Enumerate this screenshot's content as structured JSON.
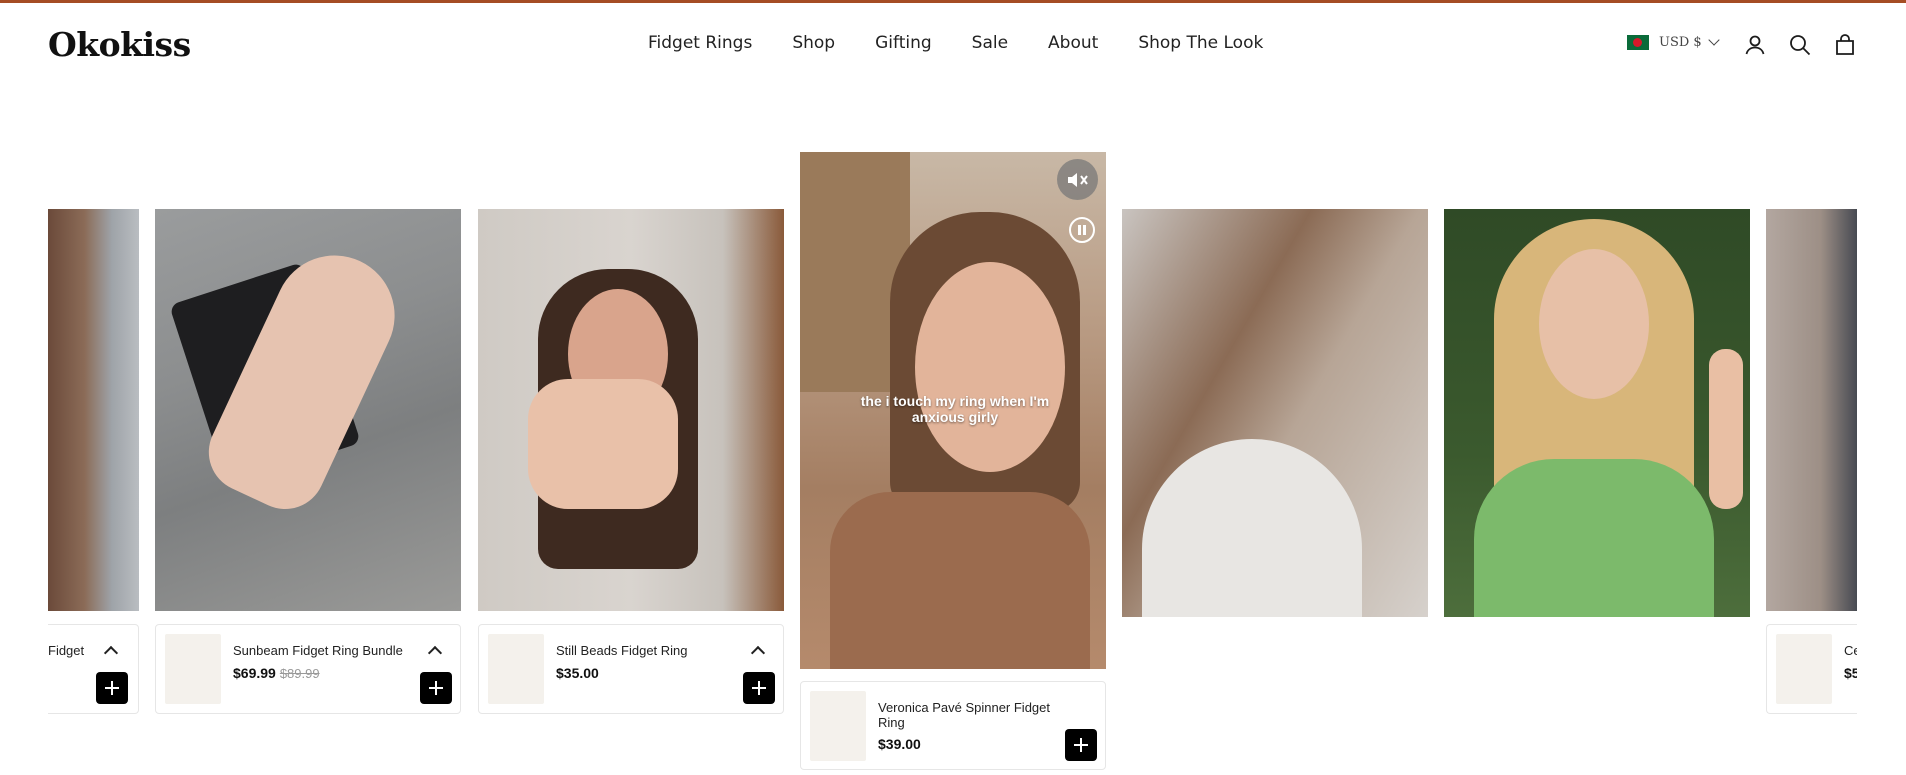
{
  "brand": {
    "logo": "Okokiss"
  },
  "nav": [
    "Fidget Rings",
    "Shop",
    "Gifting",
    "Sale",
    "About",
    "Shop The Look"
  ],
  "currency": {
    "label": "USD $",
    "flag_icon": "bangladesh-flag-icon"
  },
  "header_icons": [
    "account-icon",
    "search-icon",
    "cart-icon"
  ],
  "videos": {
    "left_partial": {
      "product_name": "Fidget"
    },
    "card1": {
      "product_name": "Sunbeam Fidget Ring Bundle",
      "price": "$69.99",
      "old_price": "$89.99"
    },
    "card2": {
      "product_name": "Still Beads Fidget Ring",
      "price": "$35.00"
    },
    "active": {
      "caption": "the i touch my ring when I'm anxious girly",
      "product_name": "Veronica Pavé Spinner Fidget Ring",
      "price": "$39.00"
    },
    "right_partial": {
      "product_name": "Ce",
      "price": "$5"
    }
  },
  "colors": {
    "accent_bar": "#a54d24",
    "button": "#000000"
  }
}
